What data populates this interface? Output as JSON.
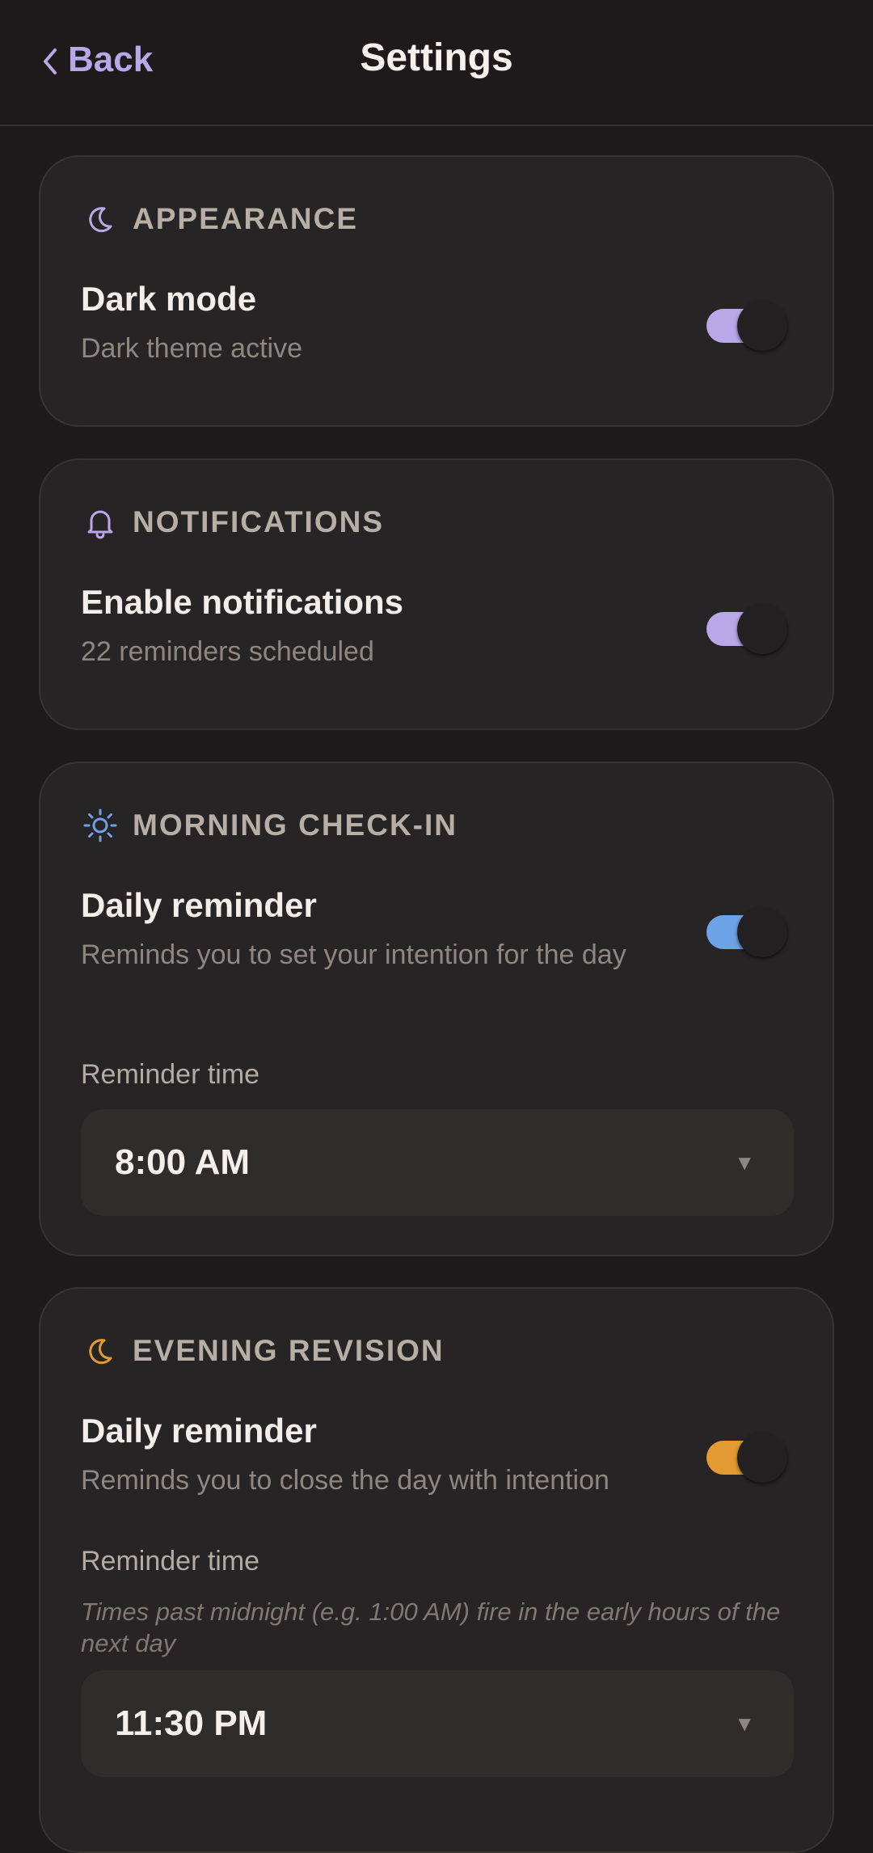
{
  "header": {
    "back_label": "Back",
    "title": "Settings"
  },
  "colors": {
    "accent_purple": "#b9a8e8",
    "accent_blue": "#6da3e6",
    "accent_orange": "#e39a33"
  },
  "appearance": {
    "icon": "moon-icon",
    "title": "APPEARANCE",
    "row_title": "Dark mode",
    "row_subtitle": "Dark theme active",
    "toggle_on": true
  },
  "notifications": {
    "icon": "bell-icon",
    "title": "NOTIFICATIONS",
    "row_title": "Enable notifications",
    "row_subtitle": "22 reminders scheduled",
    "toggle_on": true
  },
  "morning": {
    "icon": "sun-icon",
    "title": "MORNING CHECK-IN",
    "row_title": "Daily reminder",
    "row_subtitle": "Reminds you to set your intention for the day",
    "toggle_on": true,
    "time_label": "Reminder time",
    "time_value": "8:00 AM"
  },
  "evening": {
    "icon": "moon-icon",
    "title": "EVENING REVISION",
    "row_title": "Daily reminder",
    "row_subtitle": "Reminds you to close the day with intention",
    "toggle_on": true,
    "time_label": "Reminder time",
    "time_hint": "Times past midnight (e.g. 1:00 AM) fire in the early hours of the next day",
    "time_value": "11:30 PM"
  }
}
